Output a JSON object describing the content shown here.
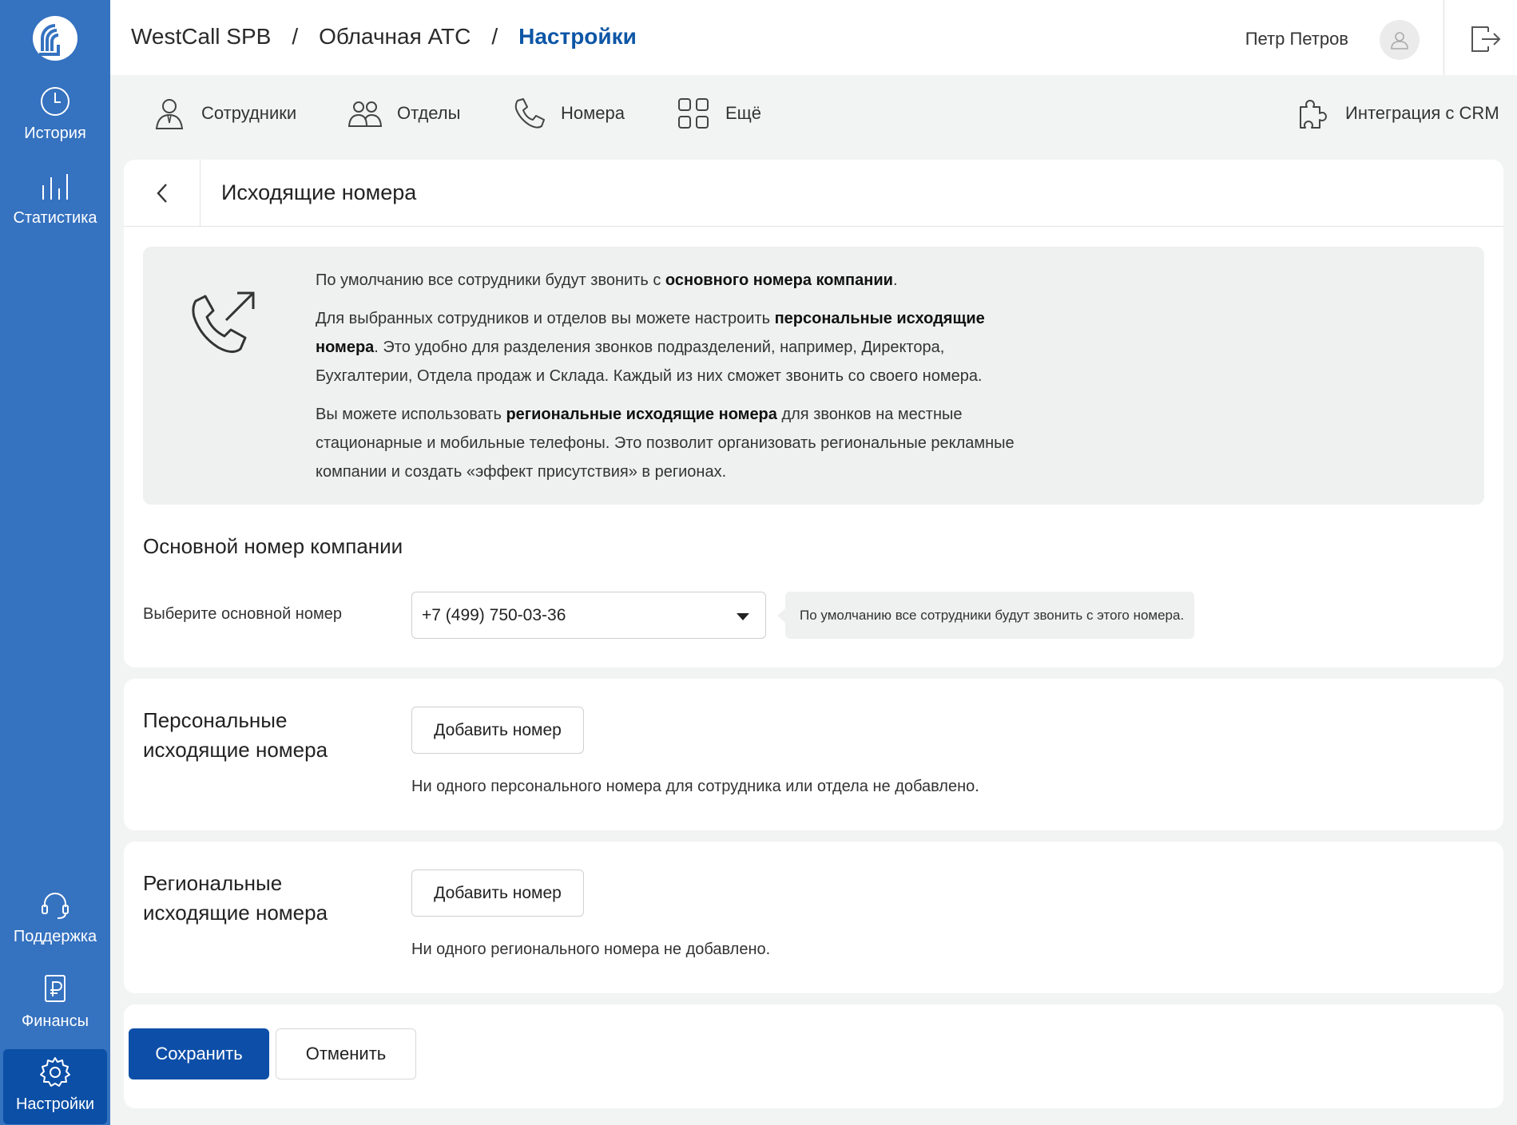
{
  "colors": {
    "sidebar": "#3572c0",
    "sidebar_active": "#0b4fa6",
    "accent": "#0d56a6",
    "primary_button": "#0d4fa8",
    "info_bg": "#eff0f0"
  },
  "sidebar": {
    "items": [
      {
        "label": "История",
        "icon": "clock-icon"
      },
      {
        "label": "Статистика",
        "icon": "bar-chart-icon"
      },
      {
        "label": "Поддержка",
        "icon": "headset-icon"
      },
      {
        "label": "Финансы",
        "icon": "ruble-document-icon"
      },
      {
        "label": "Настройки",
        "icon": "gear-icon",
        "active": true
      }
    ]
  },
  "header": {
    "breadcrumbs": [
      "WestCall SPB",
      "Облачная АТС",
      "Настройки"
    ],
    "separator": "/",
    "user_name": "Петр Петров"
  },
  "nav": {
    "items": [
      {
        "label": "Сотрудники",
        "icon": "person-icon"
      },
      {
        "label": "Отделы",
        "icon": "people-icon"
      },
      {
        "label": "Номера",
        "icon": "phone-icon"
      },
      {
        "label": "Ещё",
        "icon": "grid-icon"
      }
    ],
    "crm": {
      "label": "Интеграция с CRM",
      "icon": "puzzle-icon"
    }
  },
  "page": {
    "title": "Исходящие номера",
    "info": {
      "p1_a": "По умолчанию все сотрудники будут звонить с ",
      "p1_b": "основного номера компании",
      "p1_c": ".",
      "p2_a": "Для выбранных сотрудников и отделов вы можете настроить ",
      "p2_b": "персональные исходящие номера",
      "p2_c": ". Это удобно для разделения звонков подразделений, например, Директора, Бухгалтерии, Отдела продаж и Склада. Каждый из них сможет звонить со своего номера.",
      "p3_a": "Вы можете использовать ",
      "p3_b": "региональные исходящие номера",
      "p3_c": " для звонков на местные стационарные и мобильные телефоны. Это позволит организовать региональные рекламные компании и создать «эффект присутствия» в регионах."
    },
    "main_number": {
      "section_title": "Основной номер компании",
      "field_label": "Выберите основной номер",
      "selected_value": "+7 (499) 750-03-36",
      "hint": "По умолчанию все сотрудники будут звонить с этого номера."
    },
    "personal": {
      "title_line1": "Персональные",
      "title_line2": "исходящие номера",
      "add_button": "Добавить номер",
      "empty": "Ни одного персонального номера для сотрудника или отдела не добавлено."
    },
    "regional": {
      "title_line1": "Региональные",
      "title_line2": "исходящие номера",
      "add_button": "Добавить номер",
      "empty": "Ни одного регионального номера не добавлено."
    },
    "actions": {
      "save": "Сохранить",
      "cancel": "Отменить"
    }
  }
}
